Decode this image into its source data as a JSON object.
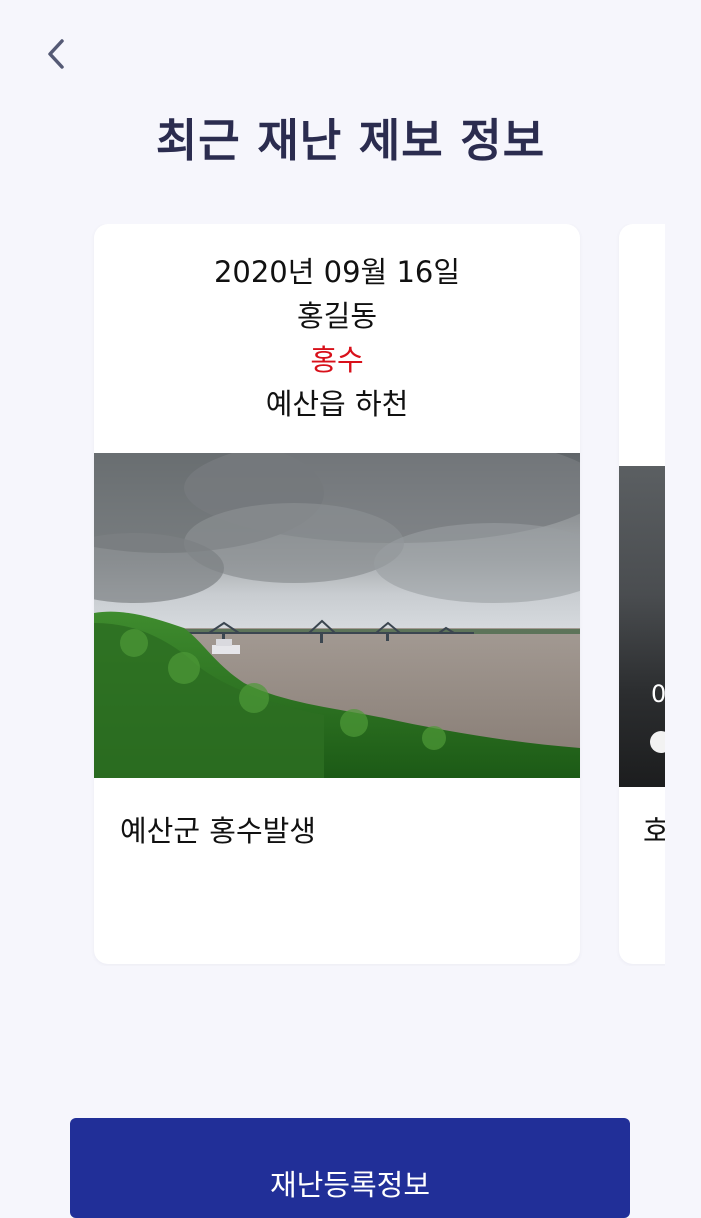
{
  "header": {
    "title": "최근 재난 제보 정보"
  },
  "cards": [
    {
      "date": "2020년 09월 16일",
      "reporter": "홍길동",
      "type": "홍수",
      "location": "예산읍 하천",
      "description": "예산군 홍수발생"
    },
    {
      "photo_text": "0",
      "description": "호"
    }
  ],
  "footer": {
    "register_label": "재난등록정보"
  },
  "colors": {
    "background": "#f6f6fc",
    "title": "#2b2c4f",
    "disaster_type": "#d8101a",
    "primary_button": "#212f98"
  }
}
